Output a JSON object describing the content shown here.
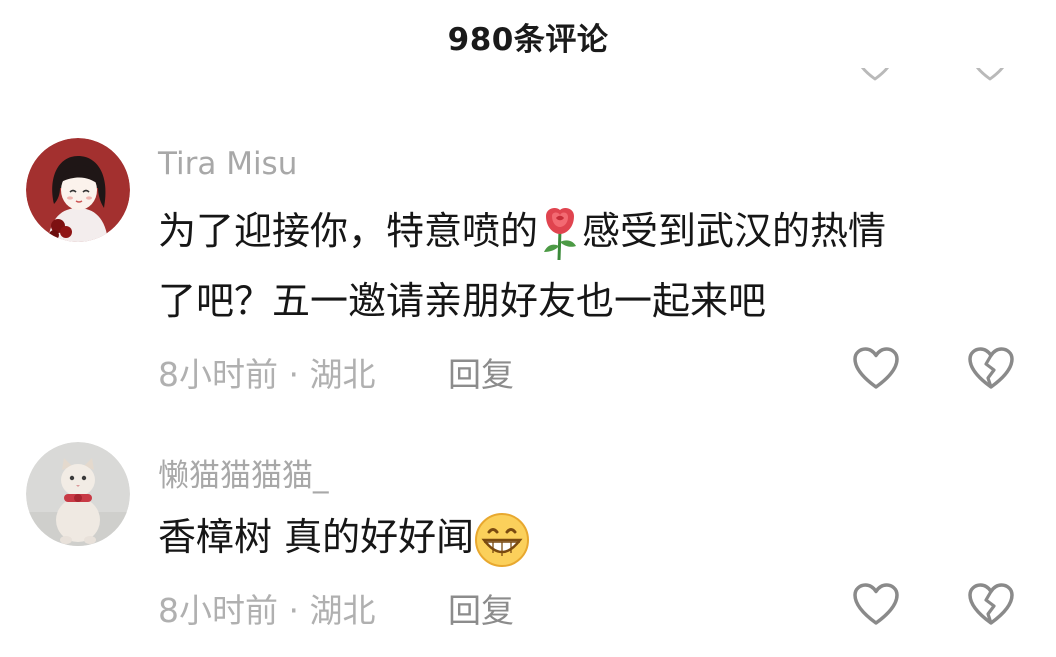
{
  "header": {
    "title": "980条评论"
  },
  "comments": [
    {
      "username": "Tira Misu",
      "text_line1": "为了迎接你，特意喷的",
      "text_line1_after": "感受到武汉的热情",
      "text_line2": "了吧？五一邀请亲朋好友也一起来吧",
      "time": "8小时前",
      "separator": "·",
      "location": "湖北",
      "reply_label": "回复",
      "emoji": "rose-icon"
    },
    {
      "username": "懒猫猫猫猫_",
      "text": "香樟树 真的好好闻",
      "time": "8小时前",
      "separator": "·",
      "location": "湖北",
      "reply_label": "回复",
      "emoji": "grinning-face-icon"
    }
  ],
  "icons": {
    "like": "heart-outline-icon",
    "dislike": "broken-heart-outline-icon"
  },
  "colors": {
    "text": "#161616",
    "muted": "#b0b0b0",
    "icon": "#8a8a8a"
  }
}
